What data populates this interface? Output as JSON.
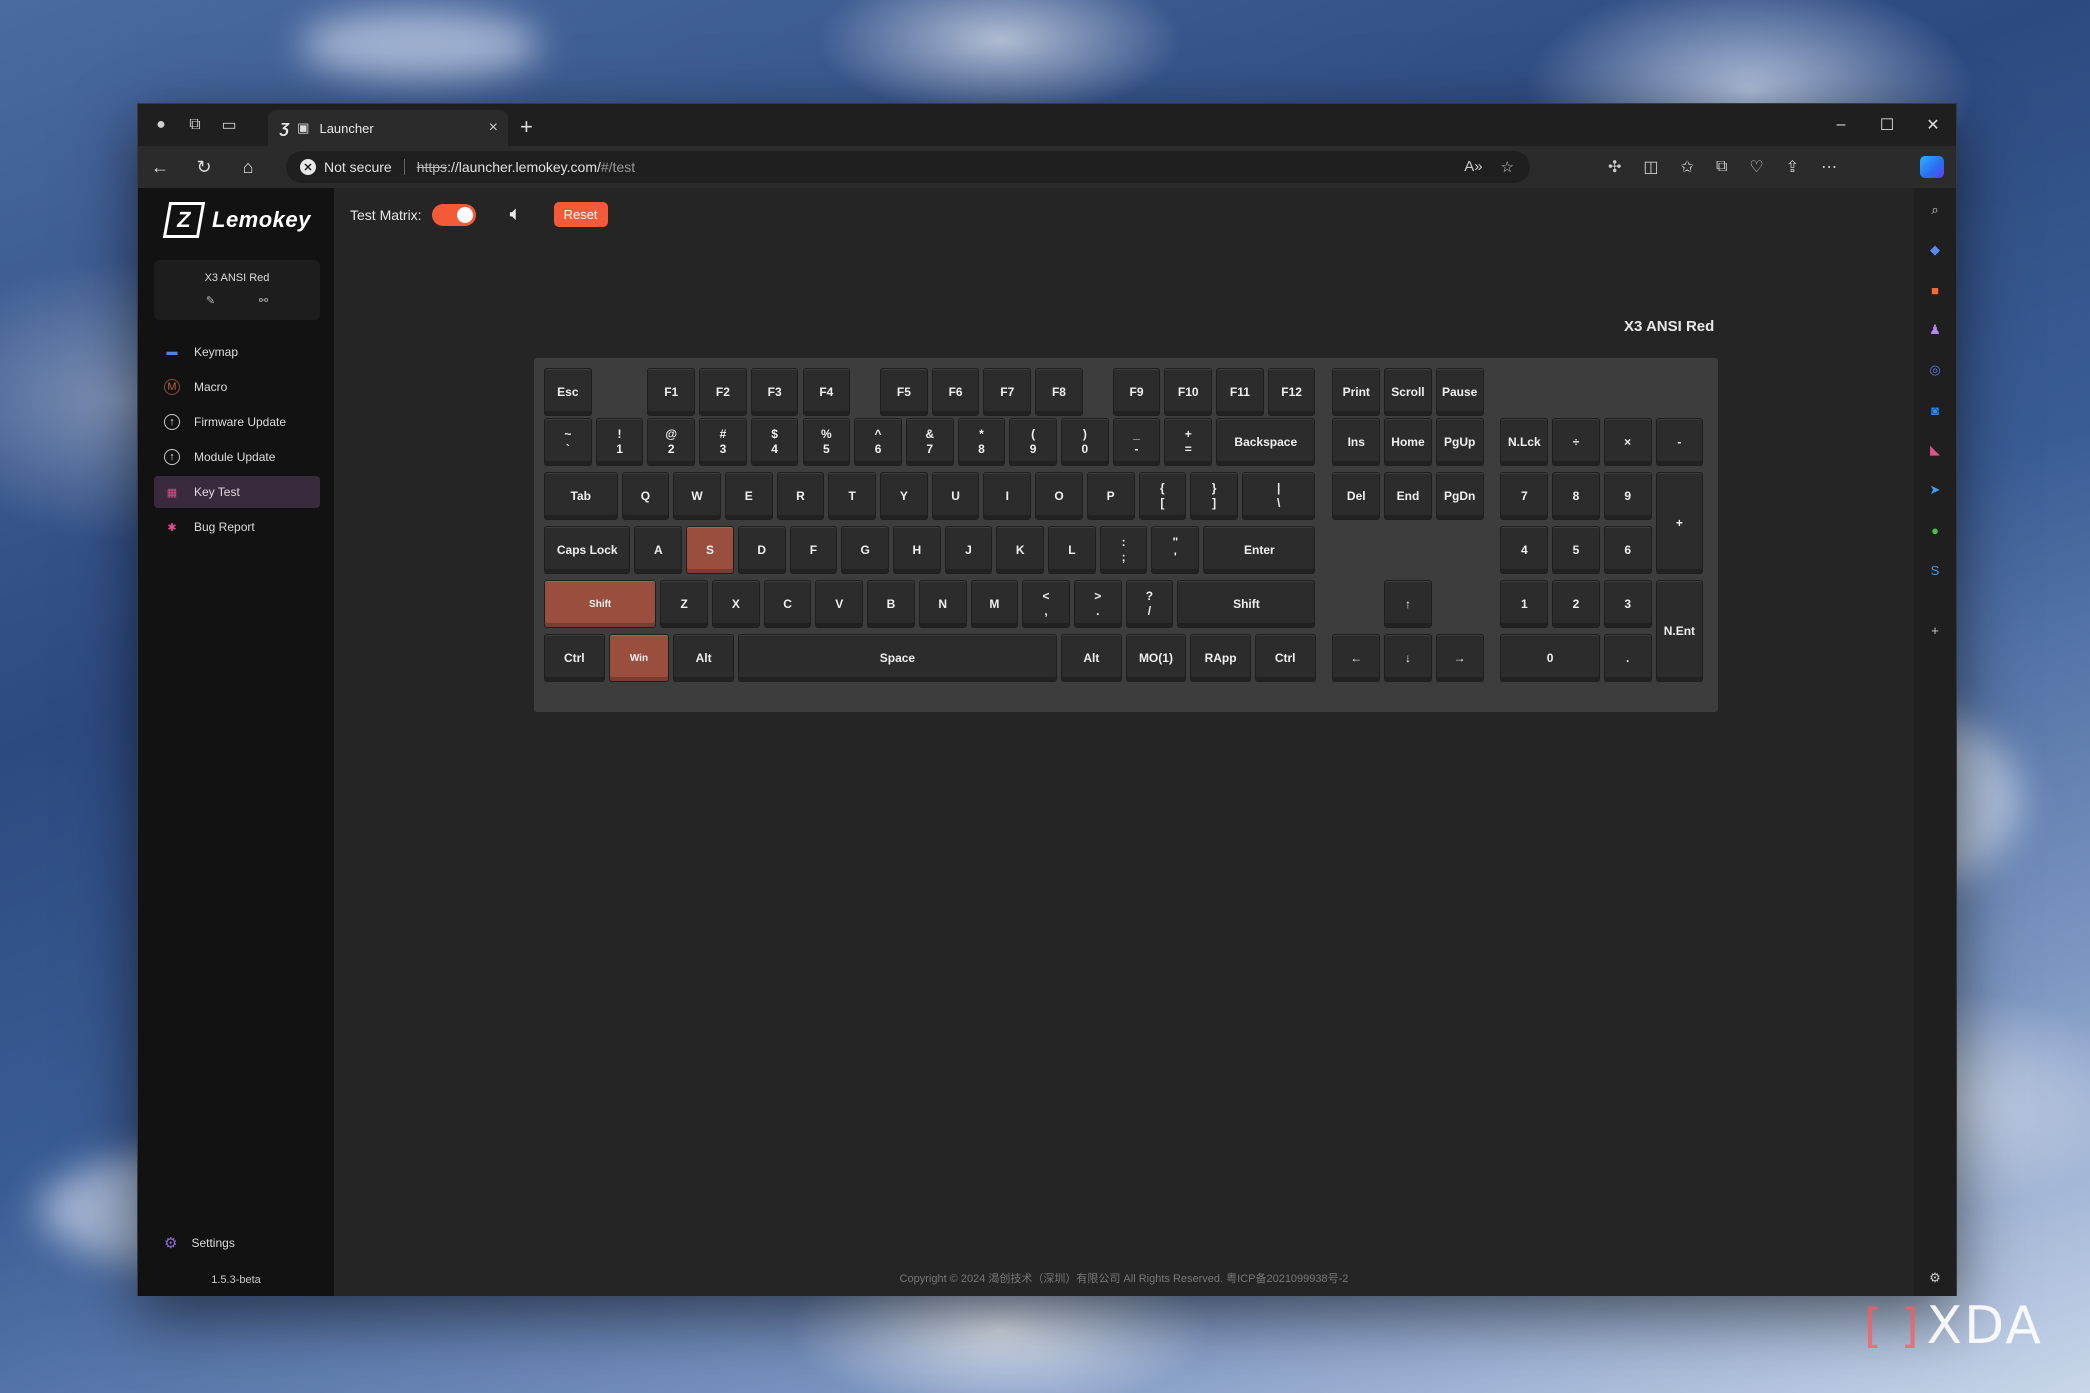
{
  "browser": {
    "tab_title": "Launcher",
    "url_status": "Not secure",
    "url_scheme": "https",
    "url_rest": "://launcher.lemokey.com/",
    "url_path": "#/test"
  },
  "sidebar": {
    "brand": "Lemokey",
    "device_name": "X3 ANSI Red",
    "items": [
      {
        "label": "Keymap",
        "icon": "keyboard-icon"
      },
      {
        "label": "Macro",
        "icon": "macro-icon"
      },
      {
        "label": "Firmware Update",
        "icon": "upload-icon"
      },
      {
        "label": "Module Update",
        "icon": "upload-icon"
      },
      {
        "label": "Key Test",
        "icon": "calendar-icon"
      },
      {
        "label": "Bug Report",
        "icon": "bug-icon"
      }
    ],
    "settings_label": "Settings",
    "version": "1.5.3-beta"
  },
  "toolbar": {
    "test_matrix_label": "Test Matrix:",
    "test_matrix_on": true,
    "reset_label": "Reset"
  },
  "keyboard": {
    "title": "X3 ANSI Red",
    "pressed_keys": [
      "S",
      "Shift",
      "Win"
    ],
    "keys": [
      {
        "t": "Esc",
        "c": 1,
        "r": 1
      },
      {
        "t": "F1",
        "c": 3,
        "r": 1
      },
      {
        "t": "F2",
        "c": 4,
        "r": 1
      },
      {
        "t": "F3",
        "c": 5,
        "r": 1
      },
      {
        "t": "F4",
        "c": 6,
        "r": 1
      },
      {
        "t": "F5",
        "c": 7.5,
        "r": 1
      },
      {
        "t": "F6",
        "c": 8.5,
        "r": 1
      },
      {
        "t": "F7",
        "c": 9.5,
        "r": 1
      },
      {
        "t": "F8",
        "c": 10.5,
        "r": 1
      },
      {
        "t": "F9",
        "c": 12,
        "r": 1
      },
      {
        "t": "F10",
        "c": 13,
        "r": 1
      },
      {
        "t": "F11",
        "c": 14,
        "r": 1
      },
      {
        "t": "F12",
        "c": 15,
        "r": 1
      },
      {
        "t": "Print",
        "c": 16.25,
        "r": 1
      },
      {
        "t": "Scroll",
        "c": 17.25,
        "r": 1
      },
      {
        "t": "Pause",
        "c": 18.25,
        "r": 1
      },
      {
        "t": "~",
        "b": "`",
        "c": 1,
        "r": 2
      },
      {
        "t": "!",
        "b": "1",
        "c": 2,
        "r": 2
      },
      {
        "t": "@",
        "b": "2",
        "c": 3,
        "r": 2
      },
      {
        "t": "#",
        "b": "3",
        "c": 4,
        "r": 2
      },
      {
        "t": "$",
        "b": "4",
        "c": 5,
        "r": 2
      },
      {
        "t": "%",
        "b": "5",
        "c": 6,
        "r": 2
      },
      {
        "t": "^",
        "b": "6",
        "c": 7,
        "r": 2
      },
      {
        "t": "&",
        "b": "7",
        "c": 8,
        "r": 2
      },
      {
        "t": "*",
        "b": "8",
        "c": 9,
        "r": 2
      },
      {
        "t": "(",
        "b": "9",
        "c": 10,
        "r": 2
      },
      {
        "t": ")",
        "b": "0",
        "c": 11,
        "r": 2
      },
      {
        "t": "_",
        "b": "-",
        "c": 12,
        "r": 2
      },
      {
        "t": "+",
        "b": "=",
        "c": 13,
        "r": 2
      },
      {
        "t": "Backspace",
        "c": 14,
        "r": 2,
        "w": 2
      },
      {
        "t": "Ins",
        "c": 16.25,
        "r": 2
      },
      {
        "t": "Home",
        "c": 17.25,
        "r": 2
      },
      {
        "t": "PgUp",
        "c": 18.25,
        "r": 2
      },
      {
        "t": "N.Lck",
        "c": 19.5,
        "r": 2
      },
      {
        "t": "÷",
        "c": 20.5,
        "r": 2
      },
      {
        "t": "×",
        "c": 21.5,
        "r": 2
      },
      {
        "t": "-",
        "c": 22.5,
        "r": 2
      },
      {
        "t": "Tab",
        "c": 1,
        "r": 3,
        "w": 1.5
      },
      {
        "t": "Q",
        "c": 2.5,
        "r": 3
      },
      {
        "t": "W",
        "c": 3.5,
        "r": 3
      },
      {
        "t": "E",
        "c": 4.5,
        "r": 3
      },
      {
        "t": "R",
        "c": 5.5,
        "r": 3
      },
      {
        "t": "T",
        "c": 6.5,
        "r": 3
      },
      {
        "t": "Y",
        "c": 7.5,
        "r": 3
      },
      {
        "t": "U",
        "c": 8.5,
        "r": 3
      },
      {
        "t": "I",
        "c": 9.5,
        "r": 3
      },
      {
        "t": "O",
        "c": 10.5,
        "r": 3
      },
      {
        "t": "P",
        "c": 11.5,
        "r": 3
      },
      {
        "t": "{",
        "b": "[",
        "c": 12.5,
        "r": 3
      },
      {
        "t": "}",
        "b": "]",
        "c": 13.5,
        "r": 3
      },
      {
        "t": "|",
        "b": "\\",
        "c": 14.5,
        "r": 3,
        "w": 1.5
      },
      {
        "t": "Del",
        "c": 16.25,
        "r": 3
      },
      {
        "t": "End",
        "c": 17.25,
        "r": 3
      },
      {
        "t": "PgDn",
        "c": 18.25,
        "r": 3
      },
      {
        "t": "7",
        "c": 19.5,
        "r": 3
      },
      {
        "t": "8",
        "c": 20.5,
        "r": 3
      },
      {
        "t": "9",
        "c": 21.5,
        "r": 3
      },
      {
        "t": "+",
        "c": 22.5,
        "r": 3,
        "h": 2
      },
      {
        "t": "Caps Lock",
        "c": 1,
        "r": 4,
        "w": 1.75
      },
      {
        "t": "A",
        "c": 2.75,
        "r": 4
      },
      {
        "t": "S",
        "c": 3.75,
        "r": 4
      },
      {
        "t": "D",
        "c": 4.75,
        "r": 4
      },
      {
        "t": "F",
        "c": 5.75,
        "r": 4
      },
      {
        "t": "G",
        "c": 6.75,
        "r": 4
      },
      {
        "t": "H",
        "c": 7.75,
        "r": 4
      },
      {
        "t": "J",
        "c": 8.75,
        "r": 4
      },
      {
        "t": "K",
        "c": 9.75,
        "r": 4
      },
      {
        "t": "L",
        "c": 10.75,
        "r": 4
      },
      {
        "t": ":",
        "b": ";",
        "c": 11.75,
        "r": 4
      },
      {
        "t": "\"",
        "b": "'",
        "c": 12.75,
        "r": 4
      },
      {
        "t": "Enter",
        "c": 13.75,
        "r": 4,
        "w": 2.25
      },
      {
        "t": "4",
        "c": 19.5,
        "r": 4
      },
      {
        "t": "5",
        "c": 20.5,
        "r": 4
      },
      {
        "t": "6",
        "c": 21.5,
        "r": 4
      },
      {
        "t": "Shift",
        "c": 1,
        "r": 5,
        "w": 2.25,
        "small": true
      },
      {
        "t": "Z",
        "c": 3.25,
        "r": 5
      },
      {
        "t": "X",
        "c": 4.25,
        "r": 5
      },
      {
        "t": "C",
        "c": 5.25,
        "r": 5
      },
      {
        "t": "V",
        "c": 6.25,
        "r": 5
      },
      {
        "t": "B",
        "c": 7.25,
        "r": 5
      },
      {
        "t": "N",
        "c": 8.25,
        "r": 5
      },
      {
        "t": "M",
        "c": 9.25,
        "r": 5
      },
      {
        "t": "<",
        "b": ",",
        "c": 10.25,
        "r": 5
      },
      {
        "t": ">",
        "b": ".",
        "c": 11.25,
        "r": 5
      },
      {
        "t": "?",
        "b": "/",
        "c": 12.25,
        "r": 5
      },
      {
        "t": "Shift",
        "c": 13.25,
        "r": 5,
        "w": 2.75
      },
      {
        "t": "↑",
        "c": 17.25,
        "r": 5
      },
      {
        "t": "1",
        "c": 19.5,
        "r": 5
      },
      {
        "t": "2",
        "c": 20.5,
        "r": 5
      },
      {
        "t": "3",
        "c": 21.5,
        "r": 5
      },
      {
        "t": "N.Ent",
        "c": 22.5,
        "r": 5,
        "h": 2
      },
      {
        "t": "Ctrl",
        "c": 1,
        "r": 6,
        "w": 1.25
      },
      {
        "t": "Win",
        "c": 2.25,
        "r": 6,
        "w": 1.25,
        "small": true
      },
      {
        "t": "Alt",
        "c": 3.5,
        "r": 6,
        "w": 1.25
      },
      {
        "t": "Space",
        "c": 4.75,
        "r": 6,
        "w": 6.25
      },
      {
        "t": "Alt",
        "c": 11,
        "r": 6,
        "w": 1.25
      },
      {
        "t": "MO(1)",
        "c": 12.25,
        "r": 6,
        "w": 1.25
      },
      {
        "t": "RApp",
        "c": 13.5,
        "r": 6,
        "w": 1.25
      },
      {
        "t": "Ctrl",
        "c": 14.75,
        "r": 6,
        "w": 1.25
      },
      {
        "t": "←",
        "c": 16.25,
        "r": 6
      },
      {
        "t": "↓",
        "c": 17.25,
        "r": 6
      },
      {
        "t": "→",
        "c": 18.25,
        "r": 6
      },
      {
        "t": "0",
        "c": 19.5,
        "r": 6,
        "w": 2
      },
      {
        "t": ".",
        "c": 21.5,
        "r": 6
      }
    ]
  },
  "footer": {
    "copyright": "Copyright © 2024 渴创技术（深圳）有限公司 All Rights Reserved. 粤ICP备2021099938号-2"
  },
  "watermark": "XDA"
}
